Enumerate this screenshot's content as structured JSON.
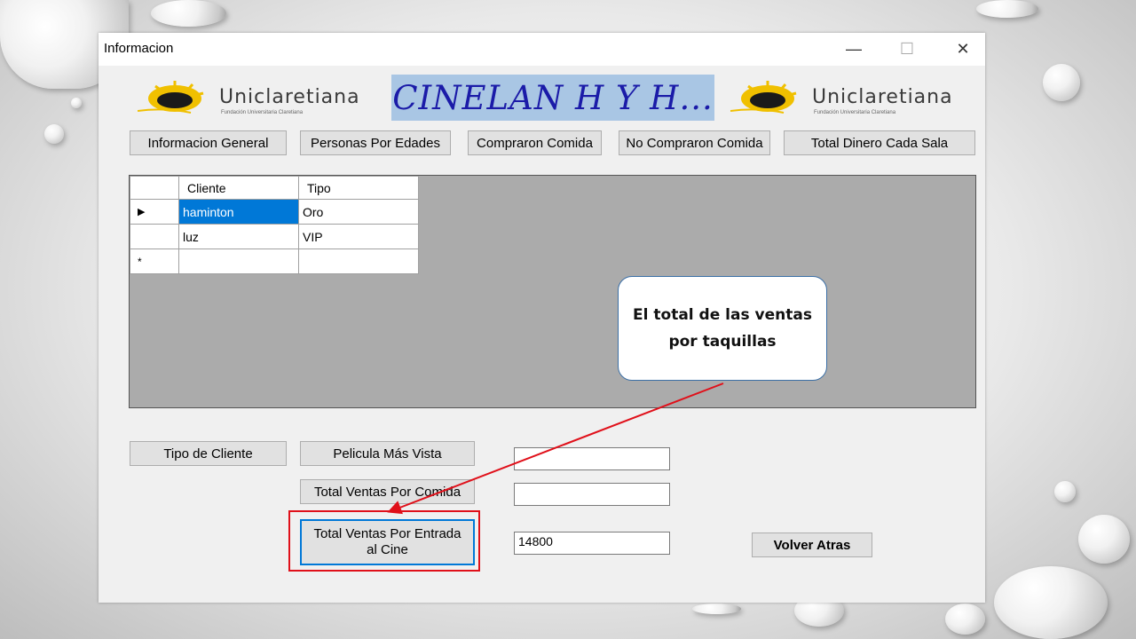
{
  "window": {
    "title": "Informacion",
    "controls": {
      "minimize": "—",
      "maximize": "☐",
      "close": "✕"
    }
  },
  "logos": {
    "brand": "Uniclaretiana",
    "subtitle": "Fundación Universitaria Claretiana"
  },
  "banner": {
    "text": "CINELAN H Y H..."
  },
  "top_buttons": {
    "info_general": "Informacion General",
    "personas_edades": "Personas Por Edades",
    "compraron_comida": "Compraron Comida",
    "no_compraron_comida": "No Compraron Comida",
    "total_dinero_sala": "Total Dinero Cada Sala"
  },
  "grid": {
    "columns": [
      "Cliente",
      "Tipo"
    ],
    "rows": [
      {
        "indicator": "▶",
        "cliente": "haminton",
        "tipo": "Oro"
      },
      {
        "indicator": "",
        "cliente": "luz",
        "tipo": "VIP"
      },
      {
        "indicator": "*",
        "cliente": "",
        "tipo": ""
      }
    ]
  },
  "bottom_buttons": {
    "tipo_cliente": "Tipo de Cliente",
    "pelicula_mas_vista": "Pelicula Más Vista",
    "total_ventas_comida": "Total Ventas Por Comida",
    "total_ventas_entrada": "Total Ventas Por Entrada al Cine",
    "volver_atras": "Volver Atras"
  },
  "fields": {
    "pelicula_value": "",
    "comida_value": "",
    "entrada_value": "14800"
  },
  "callout": {
    "text": "El total de las ventas por taquillas"
  },
  "colors": {
    "selection": "#0078d7",
    "banner_bg": "#a9c6e4",
    "banner_text": "#1b1ba8",
    "highlight": "#e0101a"
  }
}
